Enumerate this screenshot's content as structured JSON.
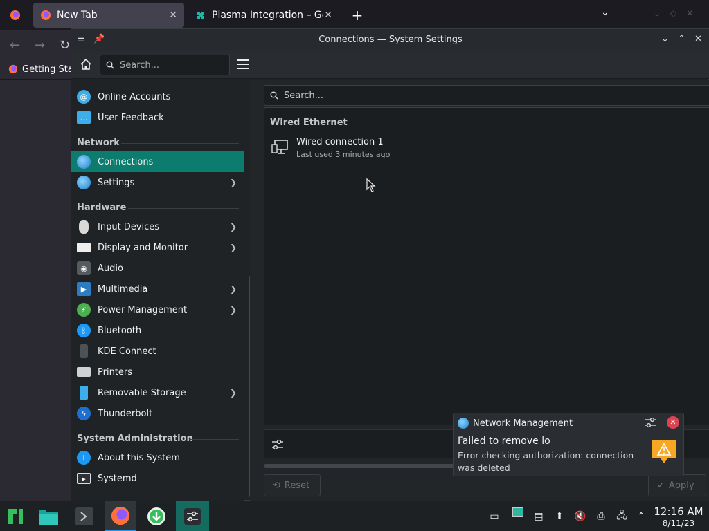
{
  "firefox": {
    "tabs": [
      {
        "title": "New Tab"
      },
      {
        "title": "Plasma Integration – Get t"
      }
    ],
    "bookmark_label": "Getting Sta"
  },
  "window": {
    "title": "Connections — System Settings"
  },
  "toolbar": {
    "search_placeholder": "Search..."
  },
  "sidebar": {
    "items_top": [
      {
        "label": "Online Accounts",
        "icon": "online-accounts-icon"
      },
      {
        "label": "User Feedback",
        "icon": "user-feedback-icon"
      }
    ],
    "section_network": "Network",
    "network_items": [
      {
        "label": "Connections",
        "icon": "connections-icon",
        "selected": true
      },
      {
        "label": "Settings",
        "icon": "network-settings-icon",
        "chevron": true
      }
    ],
    "section_hardware": "Hardware",
    "hardware_items": [
      {
        "label": "Input Devices",
        "icon": "mouse-icon",
        "chevron": true
      },
      {
        "label": "Display and Monitor",
        "icon": "monitor-icon",
        "chevron": true
      },
      {
        "label": "Audio",
        "icon": "speaker-icon"
      },
      {
        "label": "Multimedia",
        "icon": "multimedia-icon",
        "chevron": true
      },
      {
        "label": "Power Management",
        "icon": "power-icon",
        "chevron": true
      },
      {
        "label": "Bluetooth",
        "icon": "bluetooth-icon"
      },
      {
        "label": "KDE Connect",
        "icon": "phone-icon"
      },
      {
        "label": "Printers",
        "icon": "printer-icon"
      },
      {
        "label": "Removable Storage",
        "icon": "usb-drive-icon",
        "chevron": true
      },
      {
        "label": "Thunderbolt",
        "icon": "thunderbolt-icon"
      }
    ],
    "section_sysadmin": "System Administration",
    "sysadmin_items": [
      {
        "label": "About this System",
        "icon": "info-icon"
      },
      {
        "label": "Systemd",
        "icon": "systemd-icon"
      }
    ]
  },
  "main": {
    "search_placeholder": "Search...",
    "section": "Wired Ethernet",
    "connection": {
      "name": "Wired connection 1",
      "status": "Last used 3 minutes ago"
    },
    "reset_label": "Reset",
    "apply_label": "Apply"
  },
  "notification": {
    "app": "Network Management",
    "title": "Failed to remove lo",
    "body": "Error checking authorization: connection was deleted"
  },
  "clock": {
    "time": "12:16 AM",
    "date": "8/11/23"
  },
  "colors": {
    "accent": "#0b7c6d",
    "window_bg": "#202326",
    "error": "#da4453"
  }
}
